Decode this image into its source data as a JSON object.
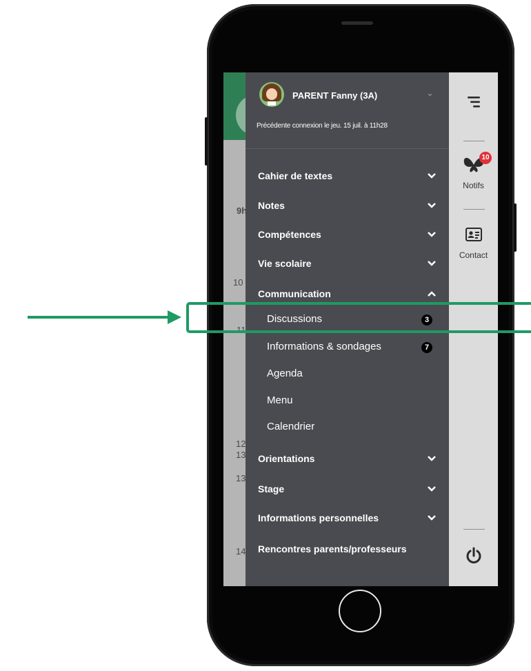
{
  "profile": {
    "name": "PARENT Fanny (3A)",
    "last_login": "Précédente connexion le jeu. 15 juil. à 11h28"
  },
  "background_times": [
    "9h",
    "10",
    "11h",
    "12",
    "13",
    "13",
    "14"
  ],
  "menu": {
    "cahier": "Cahier de textes",
    "notes": "Notes",
    "competences": "Compétences",
    "vie_scolaire": "Vie scolaire",
    "communication": "Communication",
    "discussions": "Discussions",
    "discussions_badge": "3",
    "informations": "Informations & sondages",
    "informations_badge": "7",
    "agenda": "Agenda",
    "menu": "Menu",
    "calendrier": "Calendrier",
    "orientations": "Orientations",
    "stage": "Stage",
    "infos_perso": "Informations personnelles",
    "rencontres": "Rencontres parents/professeurs"
  },
  "rail": {
    "notifs_label": "Notifs",
    "notifs_count": "10",
    "contact_label": "Contact"
  },
  "colors": {
    "drawer": "#4a4b50",
    "rail": "#dcdcdc",
    "annotation": "#1f9a64",
    "notif_badge": "#e0303a"
  }
}
